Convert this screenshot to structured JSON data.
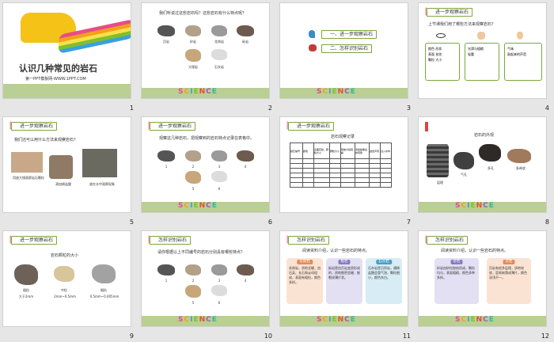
{
  "slides": [
    {
      "num": "1",
      "title": "认识几种常见的岩石",
      "subtitle": "第一PPT模板网-WWW.1PPT.COM"
    },
    {
      "num": "2",
      "question": "我们听说过这些岩石吗？这些岩石有什么特点呢？",
      "rocks": [
        "页岩",
        "砂岩",
        "花岗岩",
        "砾岩",
        "大理岩",
        "石灰岩"
      ]
    },
    {
      "num": "3",
      "items": [
        "一、进一步观察岩石",
        "二、怎样识别岩石"
      ]
    },
    {
      "num": "4",
      "header": "进一步观察岩石",
      "question": "上节课我们用了哪些方法来观察岩石？",
      "senses": [
        {
          "text": "颜色 形状\n表面 花纹\n颗粒 大小"
        },
        {
          "text": "光滑与粗糙\n轻重"
        },
        {
          "text": "气味\n敲起来的声音"
        }
      ]
    },
    {
      "num": "5",
      "header": "进一步观察岩石",
      "question": "我们还可以用什么方法来观察岩石？",
      "captions": [
        "用放大镜观察岩石颗粒",
        "滴加稀盐酸",
        "放在水中观察现象"
      ]
    },
    {
      "num": "6",
      "header": "进一步观察岩石",
      "question": "观察这几种岩石，把观察到的岩石特点记录在表格中。",
      "labels": [
        "1",
        "2",
        "3",
        "4",
        "5",
        "6"
      ]
    },
    {
      "num": "7",
      "header": "进一步观察岩石",
      "table_title": "岩石观察记录",
      "columns": [
        "岩石编号",
        "颜色",
        "表面花纹、颗粒大小",
        "颗粒大小",
        "用放大镜观察",
        "滴加盐酸后的现象",
        "敲击声音",
        "浸入水中"
      ]
    },
    {
      "num": "8",
      "header": "",
      "title": "岩石的外观",
      "labels": [
        "层理",
        "气孔",
        "多孔",
        "条带状"
      ]
    },
    {
      "num": "9",
      "header": "进一步观察岩石",
      "title": "岩石颗粒的大小",
      "rocks": [
        {
          "name": "粗粒",
          "size": "大于2mm"
        },
        {
          "name": "中粒",
          "size": "2mm~0.5mm"
        },
        {
          "name": "细粒",
          "size": "0.5mm~0.005mm"
        }
      ]
    },
    {
      "num": "10",
      "header": "怎样识别岩石",
      "question": "请你根据以上不同编号的岩石分别具有哪些特点？",
      "labels": [
        "1",
        "2",
        "3",
        "4",
        "5",
        "6"
      ]
    },
    {
      "num": "11",
      "header": "怎样识别岩石",
      "question": "阅读资料介绍，认识一些岩石的特点。",
      "cards": [
        {
          "title": "花岗岩",
          "text": "花岗岩，质地坚硬，由石英、长石和云母组成，表面有粗粒，颜色多样。"
        },
        {
          "title": "板岩",
          "text": "板岩是由页岩变质形成的，质地细密坚硬，能裂成薄片状。"
        },
        {
          "title": "石灰岩",
          "text": "石灰岩是沉积岩，遇稀盐酸会冒气泡，颗粒细小，颜色灰白。"
        }
      ]
    },
    {
      "num": "12",
      "header": "怎样识别岩石",
      "question": "阅读资料介绍，认识一些岩石的特点。",
      "cards": [
        {
          "title": "砂岩",
          "text": "砂岩由砂粒胶结而成，颗粒均匀，表面粗糙，颜色多种多样。"
        },
        {
          "title": "页岩",
          "text": "页岩有很多层理，质地较软，容易剥落成薄片，颜色深浅不一。"
        }
      ]
    }
  ],
  "science_word": [
    "S",
    "C",
    "I",
    "E",
    "N",
    "C",
    "E"
  ]
}
